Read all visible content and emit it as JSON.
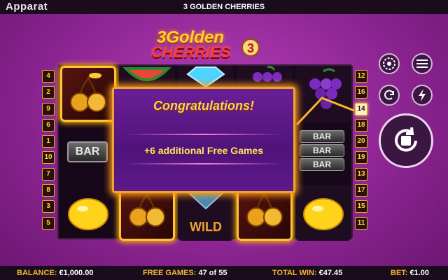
{
  "topbar": {
    "brand": "Apparat",
    "title": "3 GOLDEN CHERRIES"
  },
  "logo": {
    "line1": "3Golden",
    "line2": "CHERRIES",
    "badge": "3"
  },
  "paylines": {
    "left": [
      "4",
      "2",
      "9",
      "6",
      "1",
      "10",
      "7",
      "8",
      "3",
      "5"
    ],
    "right": [
      "12",
      "16",
      "14",
      "18",
      "20",
      "19",
      "13",
      "17",
      "15",
      "11"
    ],
    "active_right": "14"
  },
  "reels": [
    [
      "cherries",
      "lemon"
    ],
    [
      "watermelon",
      "cherries"
    ],
    [
      "diamond",
      "diamond-wild"
    ],
    [
      "grapes",
      "cherries"
    ],
    [
      "grapes",
      "bar-triple",
      "lemon"
    ]
  ],
  "symbols": {
    "bar": "BAR",
    "wild": "WILD"
  },
  "popup": {
    "title": "Congratulations!",
    "message": "+6 additional Free Games"
  },
  "controls": {
    "icons": [
      "chip-settings-icon",
      "menu-icon",
      "autoplay-icon",
      "turbo-icon",
      "spin-icon"
    ]
  },
  "bottombar": {
    "balance_label": "BALANCE:",
    "balance_value": "€1,000.00",
    "free_games_label": "FREE GAMES:",
    "free_games_value": "47 of 55",
    "total_win_label": "TOTAL WIN:",
    "total_win_value": "€47.45",
    "bet_label": "BET:",
    "bet_value": "€1.00"
  },
  "colors": {
    "accent": "#f2b933",
    "background": "#8d2592",
    "bar": "#1a0c1d",
    "frame": "#f0a52c"
  }
}
